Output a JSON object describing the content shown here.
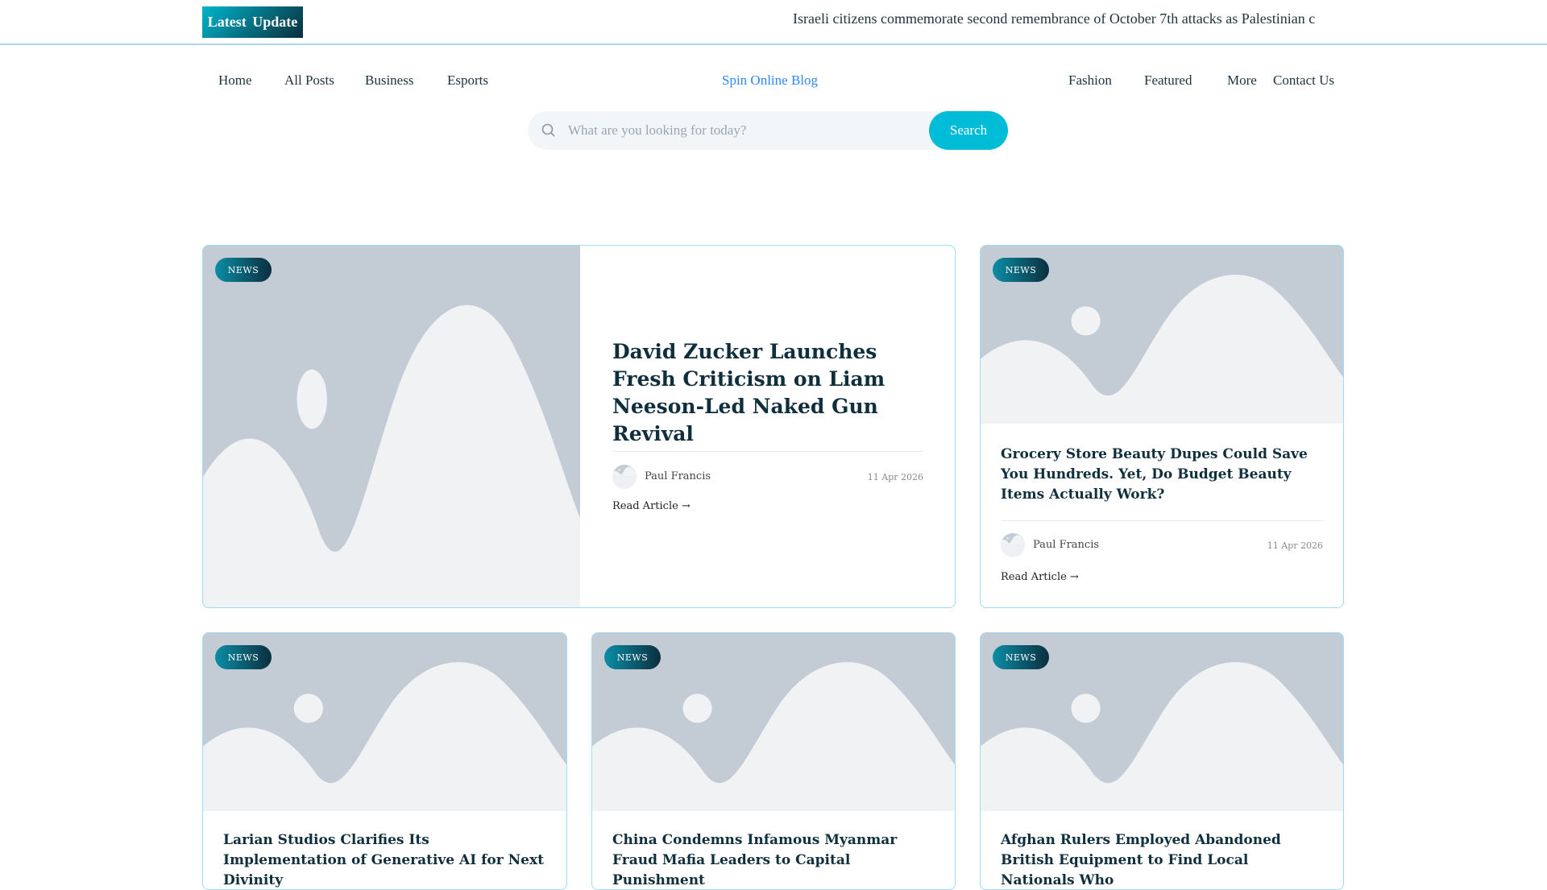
{
  "topbar": {
    "latest_label": "Latest  Update",
    "ticker": "Israeli citizens commemorate second remembrance of October 7th attacks as Palestinian c"
  },
  "nav": {
    "left": [
      "Home",
      "All Posts",
      "Business",
      "Esports"
    ],
    "brand": "Spin Online Blog",
    "right": [
      "Fashion",
      "Featured",
      "More",
      "Contact Us"
    ]
  },
  "search": {
    "placeholder": "What are you looking for today?",
    "button": "Search"
  },
  "articles": [
    {
      "badge": "NEWS",
      "title": "David Zucker Launches Fresh Criticism on Liam Neeson-Led Naked Gun Revival",
      "author": "Paul Francis",
      "date": "11 Apr 2026",
      "read": "Read Article  →"
    },
    {
      "badge": "NEWS",
      "title": "Grocery Store Beauty Dupes Could Save You Hundreds. Yet, Do Budget Beauty Items Actually Work?",
      "author": "Paul Francis",
      "date": "11 Apr 2026",
      "read": "Read Article  →"
    },
    {
      "badge": "NEWS",
      "title": "Larian Studios Clarifies Its Implementation of Generative AI for Next Divinity"
    },
    {
      "badge": "NEWS",
      "title": "China Condemns Infamous Myanmar Fraud Mafia Leaders to Capital Punishment"
    },
    {
      "badge": "NEWS",
      "title": "Afghan Rulers Employed Abandoned British Equipment to Find Local Nationals Who"
    }
  ]
}
